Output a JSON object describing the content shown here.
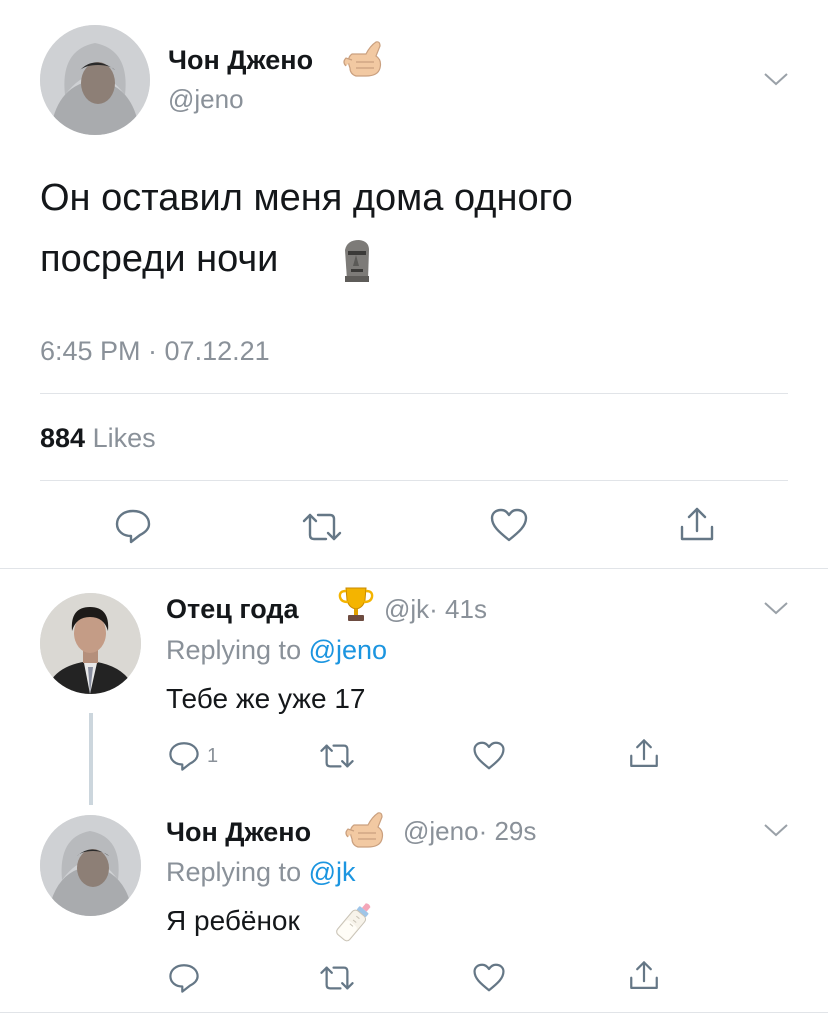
{
  "main_tweet": {
    "author_name": "Чон Джено",
    "author_emoji": "call-me-hand-emoji",
    "handle": "@jeno",
    "text_line1": "Он оставил меня дома одного",
    "text_line2": "посреди ночи",
    "text_emoji": "moai-emoji",
    "timestamp": "6:45 PM · 07.12.21",
    "likes_count": "884",
    "likes_label": "Likes"
  },
  "reply1": {
    "author_name": "Отец года",
    "author_emoji": "trophy-emoji",
    "handle": "@jk",
    "time": "· 41s",
    "replying_prefix": "Replying to",
    "replying_to": "@jeno",
    "text": "Тебе же уже 17",
    "reply_count": "1"
  },
  "reply2": {
    "author_name": "Чон Джено",
    "author_emoji": "call-me-hand-emoji",
    "handle": "@jeno",
    "time": "· 29s",
    "replying_prefix": "Replying to",
    "replying_to": "@jk",
    "text": "Я ребёнок",
    "text_emoji": "baby-bottle-emoji"
  },
  "colors": {
    "text": "#14171a",
    "secondary": "#8a9199",
    "link": "#1b95e0",
    "divider": "#e1e4e8"
  }
}
